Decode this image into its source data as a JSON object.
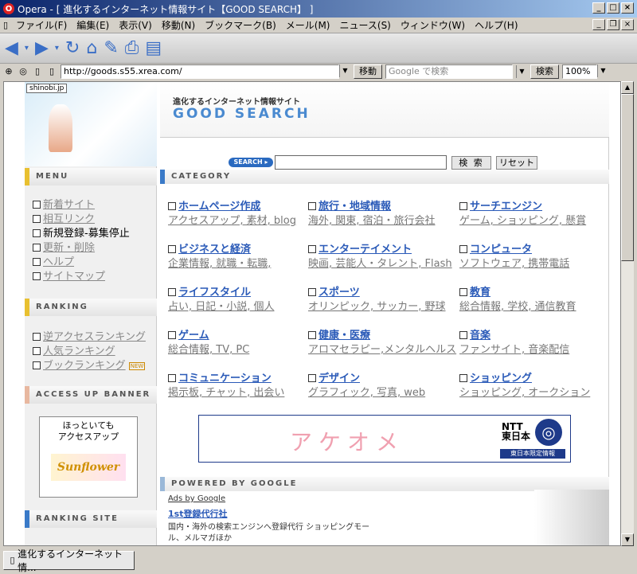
{
  "window": {
    "title": "Opera - [ 進化するインターネット情報サイト【GOOD SEARCH】 ]"
  },
  "menu": [
    "ファイル(F)",
    "編集(E)",
    "表示(V)",
    "移動(N)",
    "ブックマーク(B)",
    "メール(M)",
    "ニュース(S)",
    "ウィンドウ(W)",
    "ヘルプ(H)"
  ],
  "address": {
    "url": "http://goods.s55.xrea.com/",
    "go": "移動",
    "search_placeholder": "Google で検索",
    "search_btn": "検索",
    "zoom": "100%"
  },
  "status": {
    "tab_title": "進化するインターネット情..."
  },
  "side": {
    "badge": "shinobi.jp",
    "menu_head": "MENU",
    "menu_items": [
      "新着サイト",
      "相互リンク",
      "新規登録-募集停止",
      "更新・削除",
      "ヘルプ",
      "サイトマップ"
    ],
    "ranking_head": "RANKING",
    "ranking_items": [
      "逆アクセスランキング",
      "人気ランキング",
      "ブックランキング"
    ],
    "new_badge": "NEW",
    "banner_head": "ACCESS UP BANNER",
    "banner_line1": "ほっといても",
    "banner_line2": "アクセスアップ",
    "banner_logo": "Sunflower",
    "rankingsite_head": "RANKING SITE"
  },
  "main": {
    "logo_sub": "進化するインターネット情報サイト",
    "logo_title": "GOOD SEARCH",
    "search_label": "SEARCH ▸",
    "search_button": "検 索",
    "reset_button": "リセット",
    "category_head": "CATEGORY",
    "categories": [
      {
        "title": "ホームページ作成",
        "subs": "アクセスアップ, 素材, blog"
      },
      {
        "title": "旅行・地域情報",
        "subs": "海外, 関東, 宿泊・旅行会社"
      },
      {
        "title": "サーチエンジン",
        "subs": "ゲーム, ショッピング, 懸賞"
      },
      {
        "title": "ビジネスと経済",
        "subs": "企業情報, 就職・転職,"
      },
      {
        "title": "エンターテイメント",
        "subs": "映画, 芸能人・タレント, Flash"
      },
      {
        "title": "コンピュータ",
        "subs": "ソフトウェア, 携帯電話"
      },
      {
        "title": "ライフスタイル",
        "subs": "占い, 日記・小説, 個人"
      },
      {
        "title": "スポーツ",
        "subs": "オリンピック, サッカー, 野球"
      },
      {
        "title": "教育",
        "subs": "総合情報, 学校, 通信教育"
      },
      {
        "title": "ゲーム",
        "subs": "総合情報, TV, PC"
      },
      {
        "title": "健康・医療",
        "subs": "アロマセラピー,メンタルヘルス"
      },
      {
        "title": "音楽",
        "subs": "ファンサイト, 音楽配信"
      },
      {
        "title": "コミュニケーション",
        "subs": "掲示板, チャット, 出会い"
      },
      {
        "title": "デザイン",
        "subs": "グラフィック, 写真, web"
      },
      {
        "title": "ショッピング",
        "subs": "ショッピング, オークション"
      }
    ],
    "ad": {
      "text": "アケオメ",
      "brand1": "NTT",
      "brand2": "東日本",
      "logo": "◎",
      "limited": "東日本限定情報"
    },
    "powered_head": "POWERED BY GOOGLE",
    "ads_by": "Ads by Google",
    "ad1_title": "1st登録代行社",
    "ad1_line1": "国内・海外の検索エンジンへ登録代行 ショッピングモー",
    "ad1_line2": "ル、メルマガほか"
  }
}
